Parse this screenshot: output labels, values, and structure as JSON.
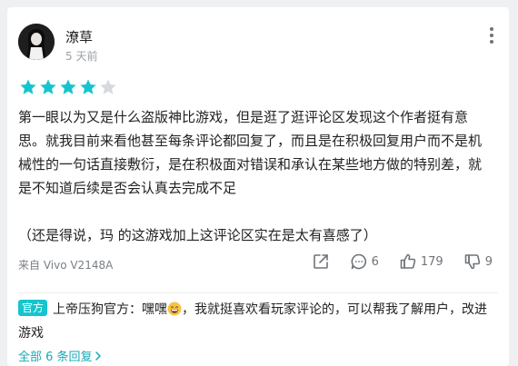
{
  "comment": {
    "username": "潦草",
    "time": "5 天前",
    "rating": 4,
    "rating_max": 5,
    "content": "第一眼以为又是什么盗版神比游戏，但是逛了逛评论区发现这个作者挺有意思。就我目前来看他甚至每条评论都回复了，而且是在积极回复用户而不是机械性的一句话直接敷衍，是在积极面对错误和承认在某些地方做的特别差，就是不知道后续是否会认真去完成不足\n\n（还是得说，玛 的这游戏加上这评论区实在是太有喜感了）",
    "device": "来自 Vivo V2148A",
    "actions": {
      "share_icon": "share-icon",
      "reply_count": "6",
      "like_count": "179",
      "dislike_count": "9"
    }
  },
  "official_reply": {
    "badge": "官方",
    "author": "上帝压狗官方",
    "separator": "：",
    "text_before_emoji": "嘿嘿",
    "emoji": "grinning-face-emoji",
    "text_after_emoji": "，我就挺喜欢看玩家评论的，可以帮我了解用户，改进游戏"
  },
  "all_replies_link": "全部 6 条回复",
  "colors": {
    "accent": "#15c5ce",
    "link": "#15a9b8",
    "star_empty": "#d7dadd",
    "muted": "#9aa0a6"
  }
}
